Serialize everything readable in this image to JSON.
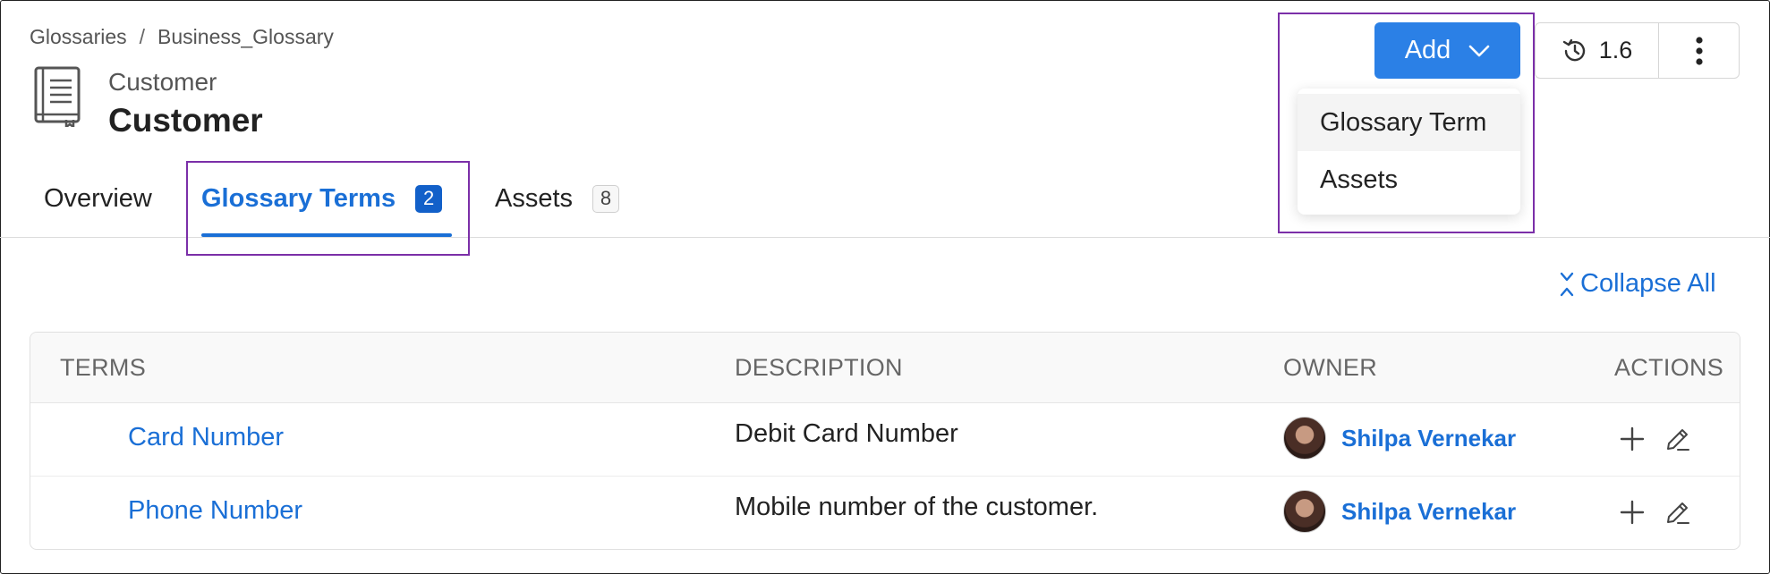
{
  "breadcrumb": {
    "root": "Glossaries",
    "separator": "/",
    "current": "Business_Glossary"
  },
  "entity": {
    "display_name": "Customer",
    "name": "Customer",
    "icon": "book-icon"
  },
  "tabs": [
    {
      "label": "Overview"
    },
    {
      "label": "Glossary Terms",
      "count": "2",
      "active": true
    },
    {
      "label": "Assets",
      "count": "8"
    }
  ],
  "header_actions": {
    "add_label": "Add",
    "add_menu": [
      "Glossary Term",
      "Assets"
    ],
    "version": "1.6"
  },
  "collapse_all_label": "Collapse All",
  "table": {
    "columns": [
      "TERMS",
      "DESCRIPTION",
      "OWNER",
      "ACTIONS"
    ],
    "rows": [
      {
        "term": "Card Number",
        "description": "Debit Card Number",
        "owner": "Shilpa Vernekar"
      },
      {
        "term": "Phone Number",
        "description": "Mobile number of the customer.",
        "owner": "Shilpa Vernekar"
      }
    ]
  },
  "colors": {
    "accent": "#1a6fd6",
    "primary_button": "#2b80e6",
    "highlight_box": "#7b2fa8"
  }
}
